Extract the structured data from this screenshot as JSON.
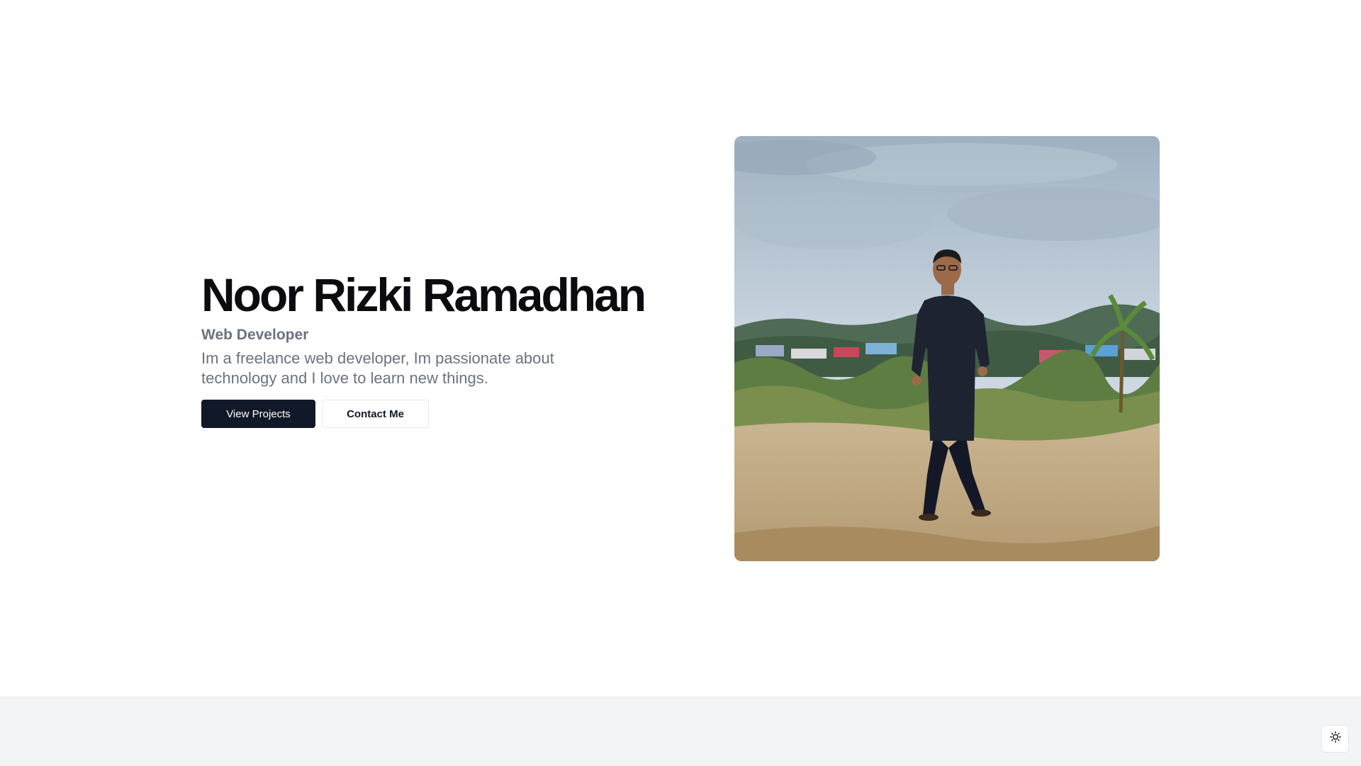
{
  "hero": {
    "name": "Noor Rizki Ramadhan",
    "role": "Web Developer",
    "description": "Im a freelance web developer, Im passionate about technology and I love to learn new things.",
    "buttons": {
      "primary_label": "View Projects",
      "secondary_label": "Contact Me"
    },
    "photo": {
      "alt": "Noor Rizki Ramadhan"
    }
  },
  "theme_toggle": {
    "icon": "sun-icon"
  },
  "colors": {
    "primary_button": "#111827",
    "heading": "#0b0b10",
    "muted_text": "#6b7280",
    "footer_band": "#f3f4f6"
  }
}
